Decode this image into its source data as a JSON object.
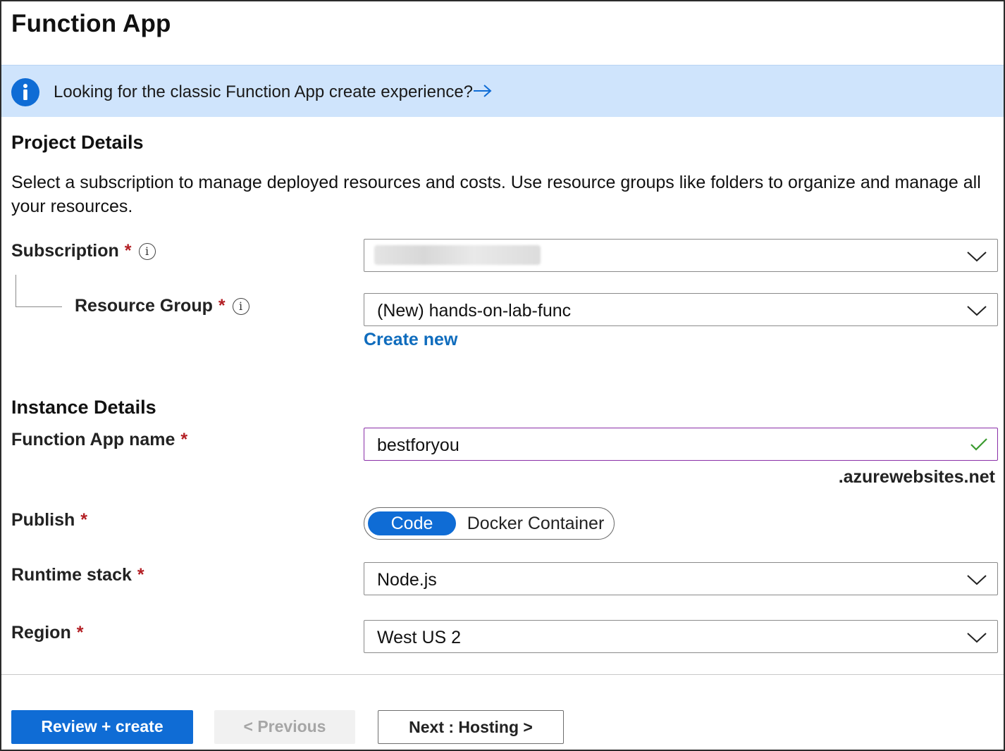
{
  "header": {
    "title": "Function App"
  },
  "banner": {
    "text": "Looking for the classic Function App create experience?",
    "icon": "info-icon",
    "link_icon": "arrow-right-icon"
  },
  "project": {
    "title": "Project Details",
    "description": "Select a subscription to manage deployed resources and costs. Use resource groups like folders to organize and manage all your resources.",
    "subscription": {
      "label": "Subscription",
      "required": "*",
      "value": ""
    },
    "resource_group": {
      "label": "Resource Group",
      "required": "*",
      "value": "(New) hands-on-lab-func",
      "create_new": "Create new"
    }
  },
  "instance": {
    "title": "Instance Details",
    "name": {
      "label": "Function App name",
      "required": "*",
      "value": "bestforyou",
      "suffix": ".azurewebsites.net"
    },
    "publish": {
      "label": "Publish",
      "required": "*",
      "options": [
        "Code",
        "Docker Container"
      ],
      "selected": "Code"
    },
    "runtime": {
      "label": "Runtime stack",
      "required": "*",
      "value": "Node.js"
    },
    "region": {
      "label": "Region",
      "required": "*",
      "value": "West US 2"
    }
  },
  "footer": {
    "review_create": "Review + create",
    "previous": "< Previous",
    "next": "Next : Hosting >"
  },
  "colors": {
    "accent": "#0f6cd5",
    "banner_bg": "#cfe4fc",
    "link": "#0f6cbd",
    "required": "#b31f24",
    "valid": "#3a9a2f",
    "focus_border": "#8a2fa8"
  }
}
